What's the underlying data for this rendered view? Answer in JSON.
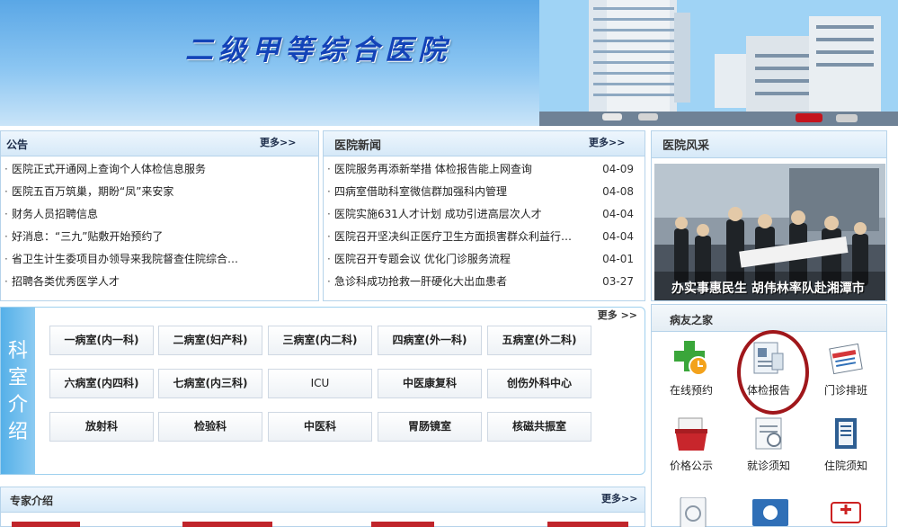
{
  "header": {
    "title": "二级甲等综合医院"
  },
  "notice": {
    "title": "公告",
    "more": "更多>>",
    "items": [
      "医院正式开通网上查询个人体检信息服务",
      "医院五百万筑巢，期盼“凤”来安家",
      "财务人员招聘信息",
      "好消息：“三九”贴敷开始预约了",
      "省卫生计生委项目办领导来我院督查住院综合…",
      "招聘各类优秀医学人才"
    ]
  },
  "news": {
    "title": "医院新闻",
    "more": "更多>>",
    "items": [
      {
        "text": "医院服务再添新举措 体检报告能上网查询",
        "date": "04-09"
      },
      {
        "text": "四病室借助科室微信群加强科内管理",
        "date": "04-08"
      },
      {
        "text": "医院实施631人才计划 成功引进高层次人才",
        "date": "04-04"
      },
      {
        "text": "医院召开坚决纠正医疗卫生方面损害群众利益行…",
        "date": "04-04"
      },
      {
        "text": "医院召开专题会议 优化门诊服务流程",
        "date": "04-01"
      },
      {
        "text": "急诊科成功抢救一肝硬化大出血患者",
        "date": "03-27"
      }
    ]
  },
  "style": {
    "title": "医院风采",
    "caption": "办实事惠民生 胡伟林率队赴湘潭市"
  },
  "departments": {
    "side_title": "科室介绍",
    "more": "更多 >>",
    "items": [
      "一病室(内一科)",
      "二病室(妇产科)",
      "三病室(内二科)",
      "四病室(外一科)",
      "五病室(外二科)",
      "六病室(内四科)",
      "七病室(内三科)",
      "ICU",
      "中医康复科",
      "创伤外科中心",
      "放射科",
      "检验科",
      "中医科",
      "胃肠镜室",
      "核磁共振室"
    ]
  },
  "patient_home": {
    "title": "病友之家",
    "items": [
      {
        "label": "在线预约",
        "icon": "online-booking-icon"
      },
      {
        "label": "体检报告",
        "icon": "checkup-report-icon"
      },
      {
        "label": "门诊排班",
        "icon": "clinic-schedule-icon"
      },
      {
        "label": "价格公示",
        "icon": "price-list-icon"
      },
      {
        "label": "就诊须知",
        "icon": "visit-notice-icon"
      },
      {
        "label": "住院须知",
        "icon": "inpatient-notice-icon"
      }
    ]
  },
  "experts": {
    "title": "专家介绍",
    "more": "更多>>"
  },
  "colors": {
    "accent": "#1343b8",
    "panel_border": "#b6d3ea",
    "side_bar": "#55b0e8",
    "highlight_ring": "#a0171b"
  }
}
